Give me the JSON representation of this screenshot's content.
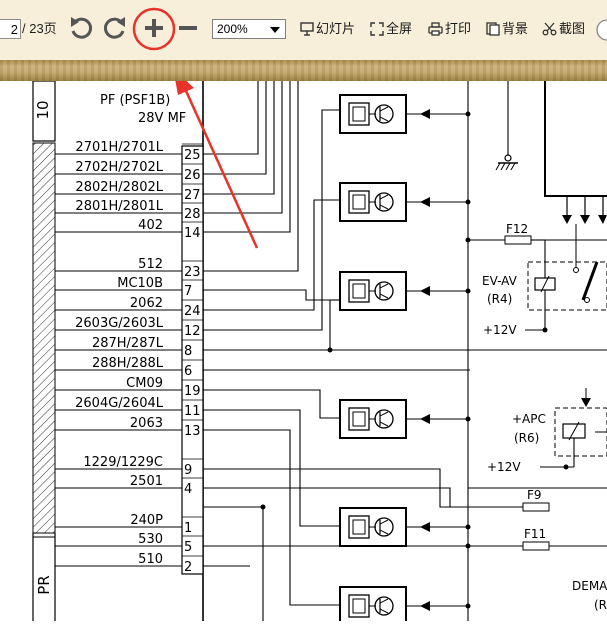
{
  "toolbar": {
    "page_current": "2",
    "page_total": "/ 23页",
    "zoom_value": "200%",
    "slideshow_label": "幻灯片",
    "fullscreen_label": "全屏",
    "print_label": "打印",
    "background_label": "背景",
    "screenshot_label": "截图"
  },
  "document": {
    "header_left": "10",
    "header_pf": "PF (PSF1B)",
    "header_28v": "28V MF",
    "labels": [
      "2701H/2701L",
      "2702H/2702L",
      "2802H/2802L",
      "2801H/2801L",
      "402",
      "512",
      "MC10B",
      "2062",
      "2603G/2603L",
      "287H/287L",
      "288H/288L",
      "CM09",
      "2604G/2604L",
      "2063",
      "1229/1229C",
      "2501",
      "240P",
      "530",
      "510"
    ],
    "pins": [
      "25",
      "26",
      "27",
      "28",
      "14",
      "23",
      "7",
      "24",
      "12",
      "8",
      "6",
      "19",
      "11",
      "13",
      "9",
      "4",
      "1",
      "5",
      "2"
    ],
    "f12": "F12",
    "ev_av": "EV-AV",
    "r4": "(R4)",
    "plus12v_a": "+12V",
    "apc": "+APC",
    "r6": "(R6)",
    "plus12v_b": "+12V",
    "f9": "F9",
    "f11": "F11",
    "demar": "DEMAR",
    "r_partial": "(R",
    "side_pr": "PR"
  },
  "colors": {
    "toolbar_bg": "#f7efd9",
    "annotation_red": "#e8332a",
    "wood": "#c4a86c"
  }
}
